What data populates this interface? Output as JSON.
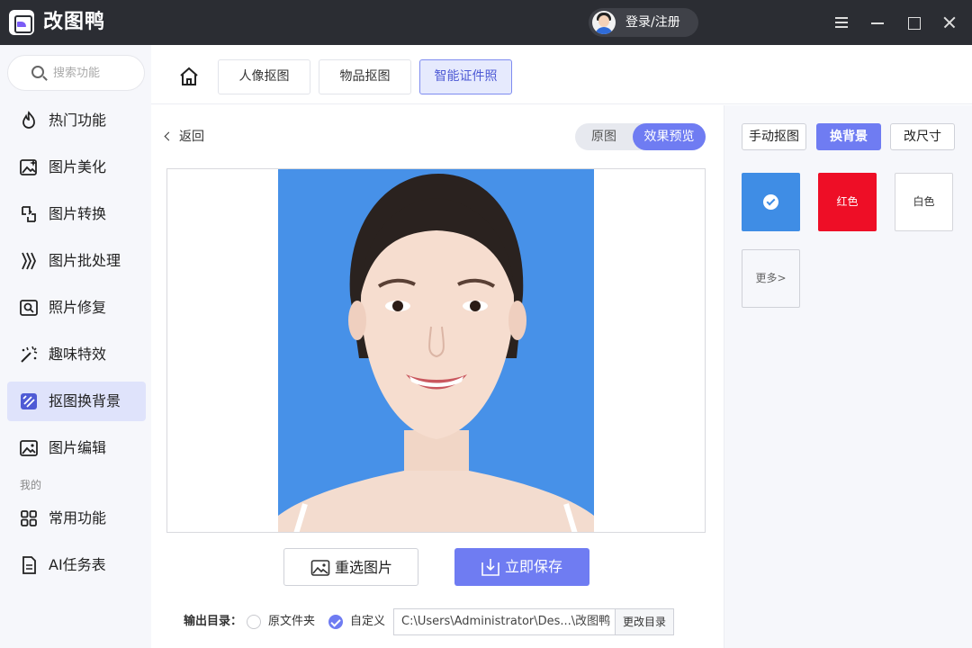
{
  "app": {
    "title": "改图鸭",
    "login_label": "登录/注册"
  },
  "sidebar": {
    "search_placeholder": "搜索功能",
    "items": [
      {
        "label": "热门功能",
        "icon": "fire-icon"
      },
      {
        "label": "图片美化",
        "icon": "image-sparkle-icon"
      },
      {
        "label": "图片转换",
        "icon": "convert-icon"
      },
      {
        "label": "图片批处理",
        "icon": "batch-icon"
      },
      {
        "label": "照片修复",
        "icon": "photo-repair-icon"
      },
      {
        "label": "趣味特效",
        "icon": "magic-wand-icon"
      },
      {
        "label": "抠图换背景",
        "icon": "cutout-icon",
        "active": true
      },
      {
        "label": "图片编辑",
        "icon": "image-edit-icon"
      }
    ],
    "section_mine": "我的",
    "mine_items": [
      {
        "label": "常用功能",
        "icon": "grid-icon"
      },
      {
        "label": "AI任务表",
        "icon": "document-icon"
      }
    ]
  },
  "tabs": [
    {
      "label": "人像抠图"
    },
    {
      "label": "物品抠图"
    },
    {
      "label": "智能证件照",
      "active": true
    }
  ],
  "main": {
    "back_label": "返回",
    "view_toggle": {
      "original": "原图",
      "preview": "效果预览",
      "selected": "效果预览"
    },
    "reselect_label": "重选图片",
    "save_label": "立即保存",
    "output": {
      "label": "输出目录：",
      "option_original": "原文件夹",
      "option_custom": "自定义",
      "selected": "自定义",
      "path": "C:\\Users\\Administrator\\Des...\\改图鸭",
      "change_label": "更改目录"
    }
  },
  "right_panel": {
    "tabs": [
      {
        "label": "手动抠图"
      },
      {
        "label": "换背景",
        "active": true
      },
      {
        "label": "改尺寸"
      }
    ],
    "colors": [
      {
        "label": "",
        "hex": "#3f8de5",
        "selected": true
      },
      {
        "label": "红色",
        "hex": "#ee0e26"
      },
      {
        "label": "白色",
        "hex": "#ffffff"
      }
    ],
    "more_label": "更多>"
  },
  "theme": {
    "accent": "#6f7cf2",
    "titlebar": "#2b2d33",
    "sidebar_bg": "#f6f7fb",
    "photo_bg": "#4791e8"
  }
}
